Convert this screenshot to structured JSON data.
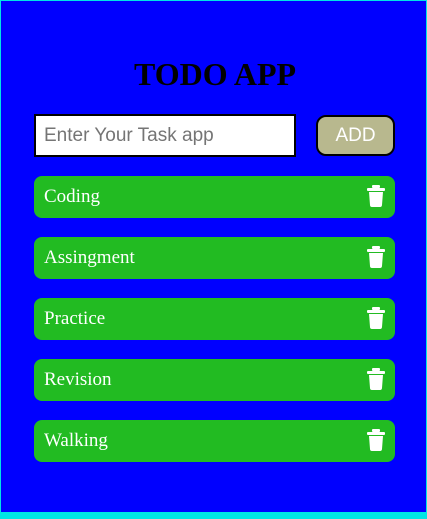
{
  "app": {
    "title": "TODO APP"
  },
  "form": {
    "input_value": "",
    "input_placeholder": "Enter Your Task app",
    "add_label": "ADD"
  },
  "tasks": [
    {
      "label": "Coding",
      "icon": "trash-icon"
    },
    {
      "label": "Assingment",
      "icon": "trash-icon"
    },
    {
      "label": "Practice",
      "icon": "trash-icon"
    },
    {
      "label": "Revision",
      "icon": "trash-icon"
    },
    {
      "label": "Walking",
      "icon": "trash-icon"
    }
  ],
  "colors": {
    "page_border": "#00e5e5",
    "app_background": "#0000ff",
    "task_background": "#22bb22",
    "add_button": "#b8b88e"
  }
}
